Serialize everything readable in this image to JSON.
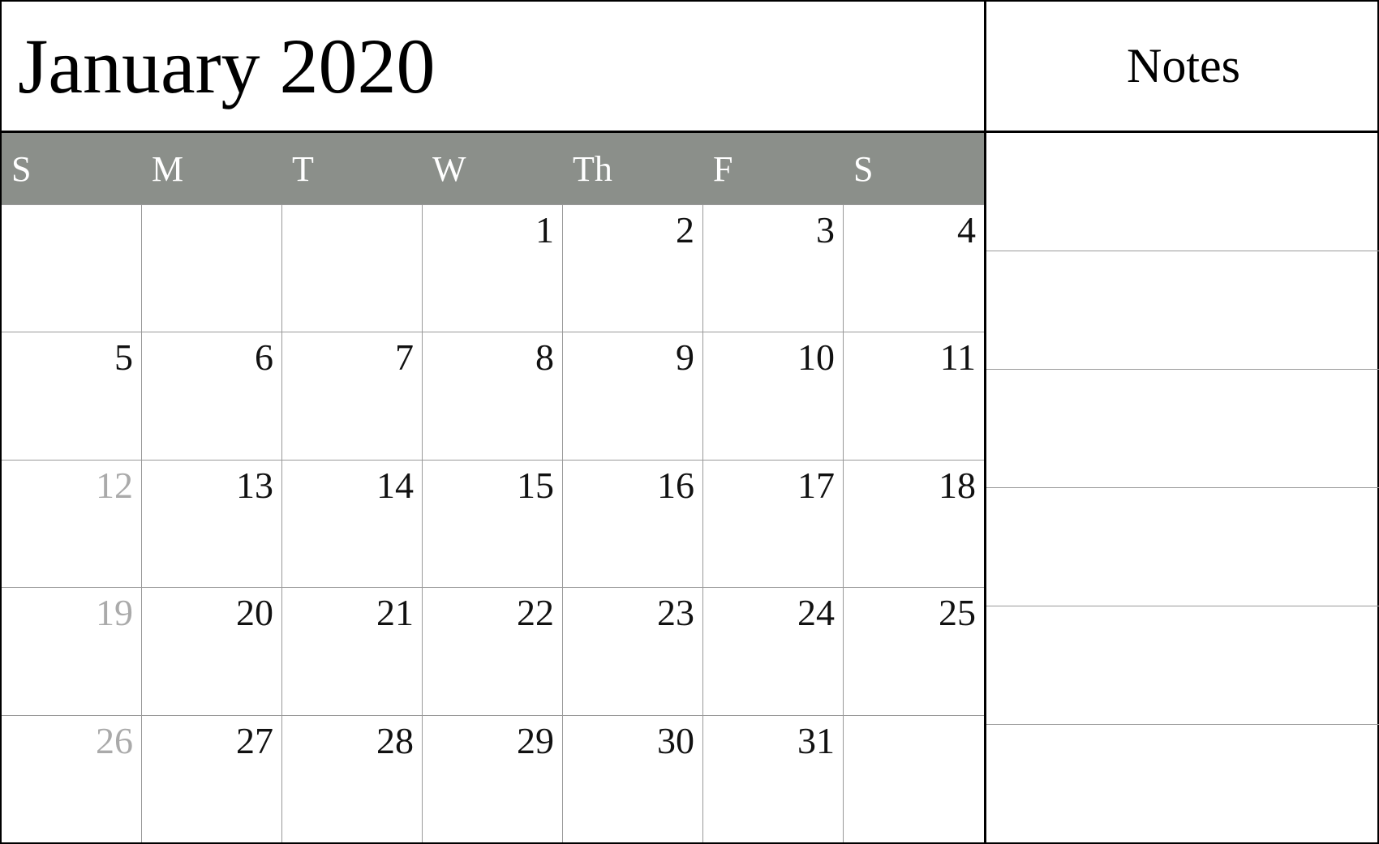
{
  "header": {
    "title": "January 2020",
    "notes_label": "Notes"
  },
  "days_header": [
    {
      "label": "S"
    },
    {
      "label": "M"
    },
    {
      "label": "T"
    },
    {
      "label": "W"
    },
    {
      "label": "Th"
    },
    {
      "label": "F"
    },
    {
      "label": "S"
    }
  ],
  "weeks": [
    {
      "days": [
        {
          "number": "",
          "muted": false,
          "empty": true
        },
        {
          "number": "",
          "muted": false,
          "empty": true
        },
        {
          "number": "",
          "muted": false,
          "empty": true
        },
        {
          "number": "1",
          "muted": false,
          "empty": false
        },
        {
          "number": "2",
          "muted": false,
          "empty": false
        },
        {
          "number": "3",
          "muted": false,
          "empty": false
        },
        {
          "number": "4",
          "muted": false,
          "empty": false
        }
      ]
    },
    {
      "days": [
        {
          "number": "5",
          "muted": false,
          "empty": false
        },
        {
          "number": "6",
          "muted": false,
          "empty": false
        },
        {
          "number": "7",
          "muted": false,
          "empty": false
        },
        {
          "number": "8",
          "muted": false,
          "empty": false
        },
        {
          "number": "9",
          "muted": false,
          "empty": false
        },
        {
          "number": "10",
          "muted": false,
          "empty": false
        },
        {
          "number": "11",
          "muted": false,
          "empty": false
        }
      ]
    },
    {
      "days": [
        {
          "number": "12",
          "muted": true,
          "empty": false
        },
        {
          "number": "13",
          "muted": false,
          "empty": false
        },
        {
          "number": "14",
          "muted": false,
          "empty": false
        },
        {
          "number": "15",
          "muted": false,
          "empty": false
        },
        {
          "number": "16",
          "muted": false,
          "empty": false
        },
        {
          "number": "17",
          "muted": false,
          "empty": false
        },
        {
          "number": "18",
          "muted": false,
          "empty": false
        }
      ]
    },
    {
      "days": [
        {
          "number": "19",
          "muted": true,
          "empty": false
        },
        {
          "number": "20",
          "muted": false,
          "empty": false
        },
        {
          "number": "21",
          "muted": false,
          "empty": false
        },
        {
          "number": "22",
          "muted": false,
          "empty": false
        },
        {
          "number": "23",
          "muted": false,
          "empty": false
        },
        {
          "number": "24",
          "muted": false,
          "empty": false
        },
        {
          "number": "25",
          "muted": false,
          "empty": false
        }
      ]
    },
    {
      "days": [
        {
          "number": "26",
          "muted": true,
          "empty": false
        },
        {
          "number": "27",
          "muted": false,
          "empty": false
        },
        {
          "number": "28",
          "muted": false,
          "empty": false
        },
        {
          "number": "29",
          "muted": false,
          "empty": false
        },
        {
          "number": "30",
          "muted": false,
          "empty": false
        },
        {
          "number": "31",
          "muted": false,
          "empty": false
        },
        {
          "number": "",
          "muted": false,
          "empty": true
        }
      ]
    }
  ],
  "notes_rows_count": 6
}
